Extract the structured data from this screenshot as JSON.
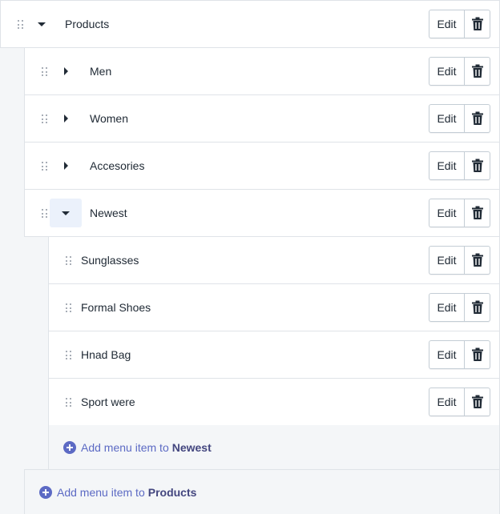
{
  "menu": {
    "root": {
      "label": "Products",
      "expanded": true
    },
    "level1": [
      {
        "label": "Men",
        "expanded": false
      },
      {
        "label": "Women",
        "expanded": false
      },
      {
        "label": "Accesories",
        "expanded": false
      },
      {
        "label": "Newest",
        "expanded": true
      }
    ],
    "level2": [
      {
        "label": "Sunglasses"
      },
      {
        "label": "Formal Shoes"
      },
      {
        "label": "Hnad Bag"
      },
      {
        "label": "Sport were"
      }
    ],
    "edit_label": "Edit",
    "add_newest": {
      "prefix": "Add menu item to",
      "target": "Newest"
    },
    "add_products": {
      "prefix": "Add menu item to",
      "target": "Products"
    }
  },
  "icons": {
    "drag": "drag-handle-icon",
    "expand": "caret-down-icon",
    "collapse": "caret-right-icon",
    "delete": "trash-icon",
    "add": "plus-circle-icon"
  },
  "colors": {
    "accent": "#5c6ac4",
    "accent_dark": "#43467f",
    "border": "#dfe3e8",
    "text": "#212b36",
    "active_toggle_bg": "#ebf1fb"
  }
}
